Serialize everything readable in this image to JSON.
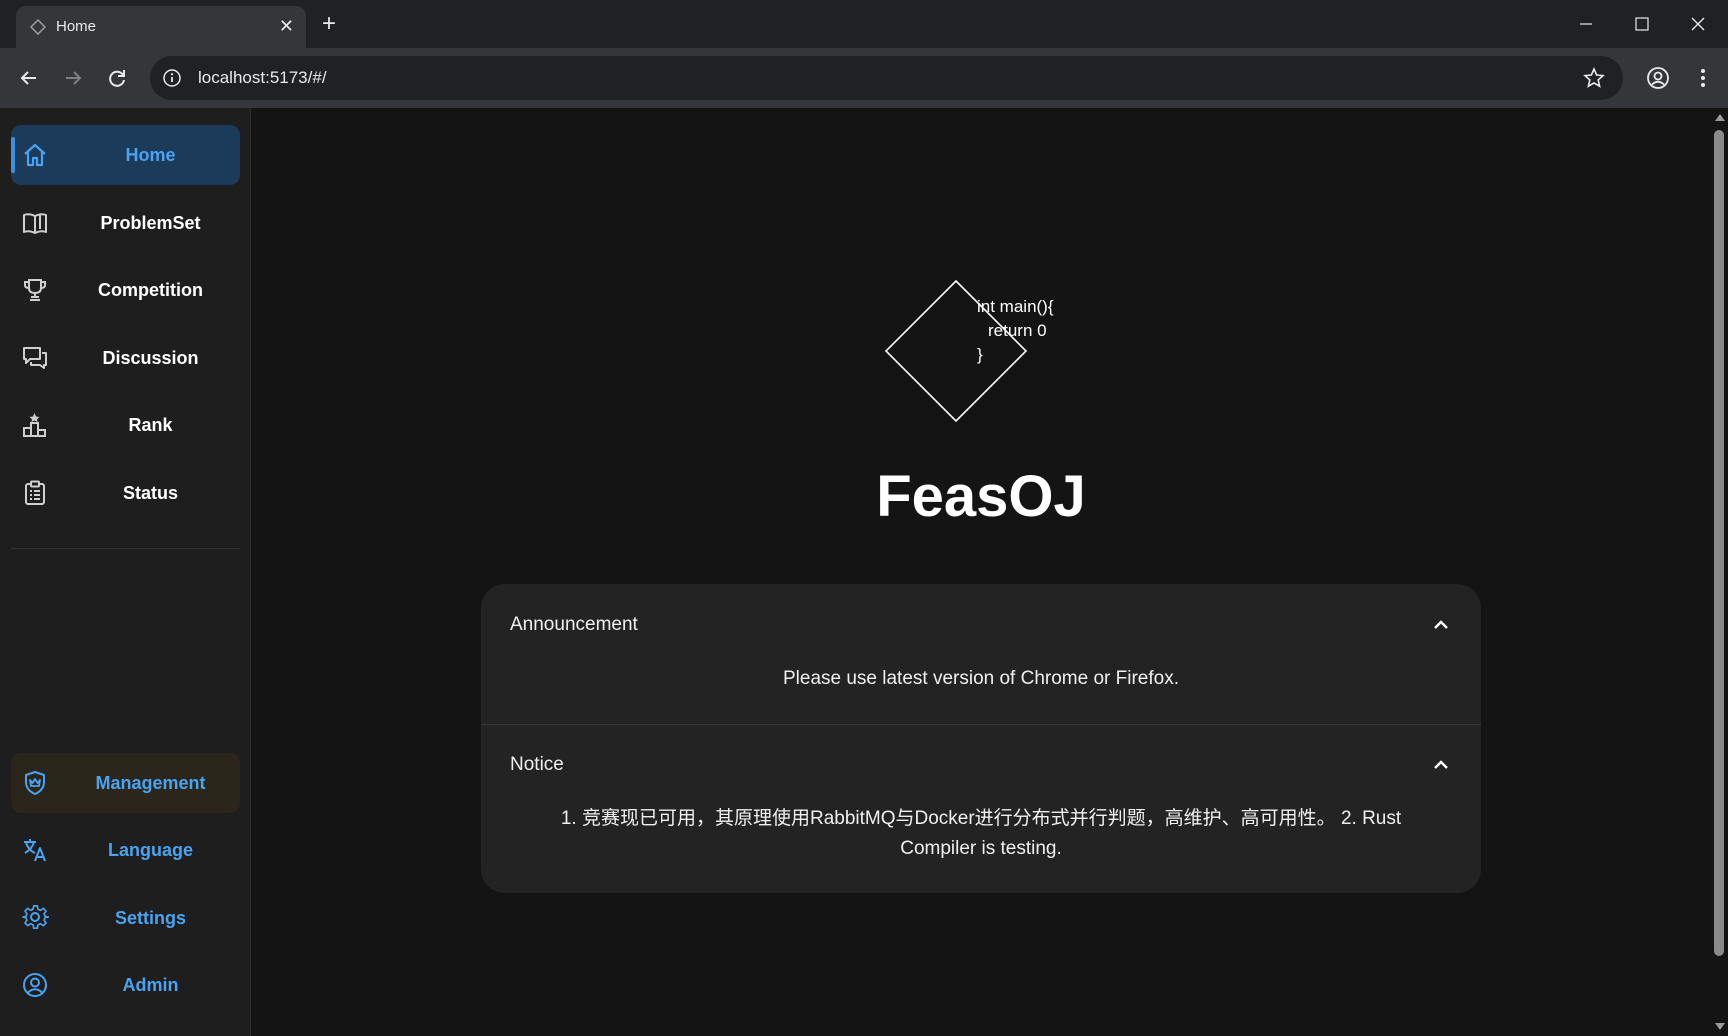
{
  "browser": {
    "tab_title": "Home",
    "tab_close": "✕",
    "new_tab": "+",
    "url": "localhost:5173/#/"
  },
  "sidebar": {
    "items": [
      {
        "label": "Home",
        "icon": "home-icon",
        "active": true
      },
      {
        "label": "ProblemSet",
        "icon": "book-icon"
      },
      {
        "label": "Competition",
        "icon": "trophy-icon"
      },
      {
        "label": "Discussion",
        "icon": "chat-icon"
      },
      {
        "label": "Rank",
        "icon": "podium-icon"
      },
      {
        "label": "Status",
        "icon": "clipboard-icon"
      }
    ],
    "bottom_items": [
      {
        "label": "Management",
        "icon": "shield-icon"
      },
      {
        "label": "Language",
        "icon": "translate-icon"
      },
      {
        "label": "Settings",
        "icon": "gear-icon"
      },
      {
        "label": "Admin",
        "icon": "user-circle-icon"
      }
    ]
  },
  "main": {
    "logo_code": [
      "int main(){",
      "return 0",
      "}"
    ],
    "title": "FeasOJ",
    "announcement": {
      "title": "Announcement",
      "body": "Please use latest version of Chrome or Firefox."
    },
    "notice": {
      "title": "Notice",
      "body": "1. 竞赛现已可用，其原理使用RabbitMQ与Docker进行分布式并行判题，高维护、高可用性。 2. Rust Compiler is testing."
    }
  },
  "colors": {
    "background": "#141414",
    "sidebar": "#1e1e1e",
    "active_nav": "#1c3a5a",
    "accent_blue": "#4aa3f0",
    "card": "#232323"
  }
}
